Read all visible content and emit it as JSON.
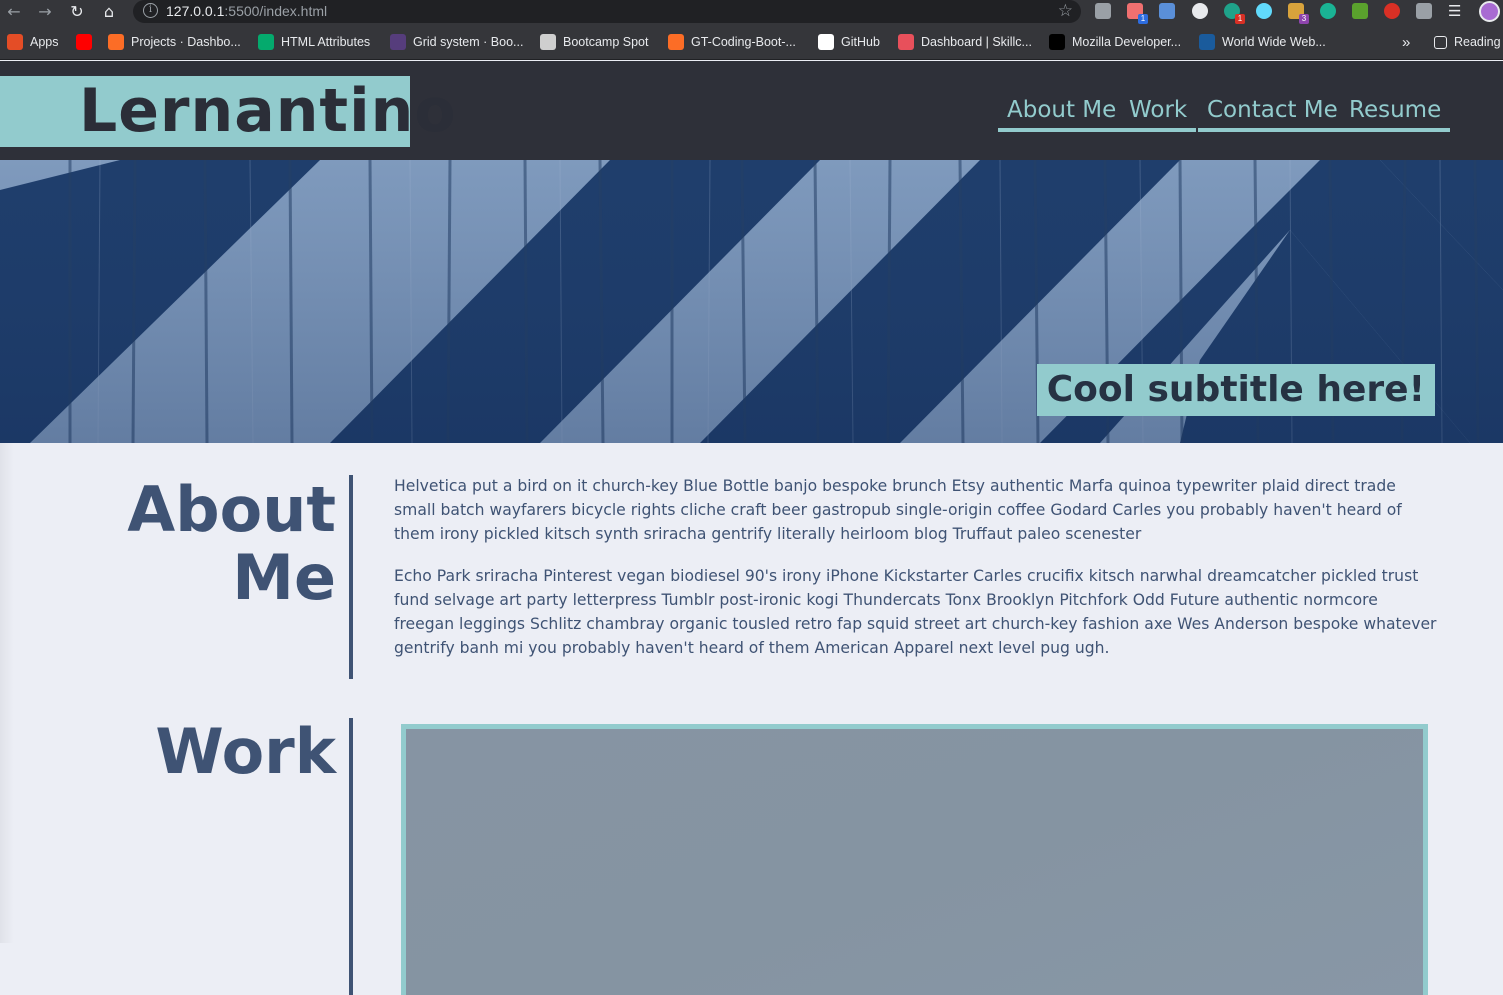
{
  "browser": {
    "url_host": "127.0.0.1",
    "url_path": ":5500/index.html",
    "bookmarks": [
      {
        "label": "Apps",
        "icon": "apps-grid-icon",
        "color": "#e44d26"
      },
      {
        "label": "",
        "icon": "youtube-icon",
        "color": "#ff0000"
      },
      {
        "label": "Projects · Dashbo...",
        "icon": "gitlab-icon",
        "color": "#fc6d26"
      },
      {
        "label": "HTML Attributes",
        "icon": "w3schools-icon",
        "color": "#04aa6d"
      },
      {
        "label": "Grid system · Boo...",
        "icon": "bootstrap-icon",
        "color": "#563d7c"
      },
      {
        "label": "Bootcamp Spot",
        "icon": "globe-icon",
        "color": "#cfcfcf"
      },
      {
        "label": "GT-Coding-Boot-...",
        "icon": "gitlab-icon",
        "color": "#fc6d26"
      },
      {
        "label": "GitHub",
        "icon": "github-icon",
        "color": "#ffffff"
      },
      {
        "label": "Dashboard | Skillc...",
        "icon": "skillcrush-icon",
        "color": "#e8505b"
      },
      {
        "label": "Mozilla Developer...",
        "icon": "mdn-icon",
        "color": "#000000"
      },
      {
        "label": "World Wide Web...",
        "icon": "w3c-icon",
        "color": "#1a5b9c"
      }
    ],
    "bookmarks_overflow": "»",
    "reading_list": "Reading"
  },
  "site": {
    "logo": "Lernantino",
    "nav": [
      "About Me",
      "Work",
      "Contact Me",
      "Resume"
    ],
    "hero_subtitle": "Cool subtitle here!",
    "about": {
      "heading_line1": "About",
      "heading_line2": "Me",
      "paragraphs": [
        "Helvetica put a bird on it church-key Blue Bottle banjo bespoke brunch Etsy authentic Marfa quinoa typewriter plaid direct trade small batch wayfarers bicycle rights cliche craft beer gastropub single-origin coffee Godard Carles you probably haven't heard of them irony pickled kitsch synth sriracha gentrify literally heirloom blog Truffaut paleo scenester",
        "Echo Park sriracha Pinterest vegan biodiesel 90's irony iPhone Kickstarter Carles crucifix kitsch narwhal dreamcatcher pickled trust fund selvage art party letterpress Tumblr post-ironic kogi Thundercats Tonx Brooklyn Pitchfork Odd Future authentic normcore freegan leggings Schlitz chambray organic tousled retro fap squid street art church-key fashion axe Wes Anderson bespoke whatever gentrify banh mi you probably haven't heard of them American Apparel next level pug ugh."
      ]
    },
    "work": {
      "heading": "Work"
    }
  },
  "colors": {
    "header_bg": "#2e3039",
    "accent_teal": "#92cbcd",
    "heading_navy": "#3f5374",
    "page_bg": "#eceef5"
  }
}
